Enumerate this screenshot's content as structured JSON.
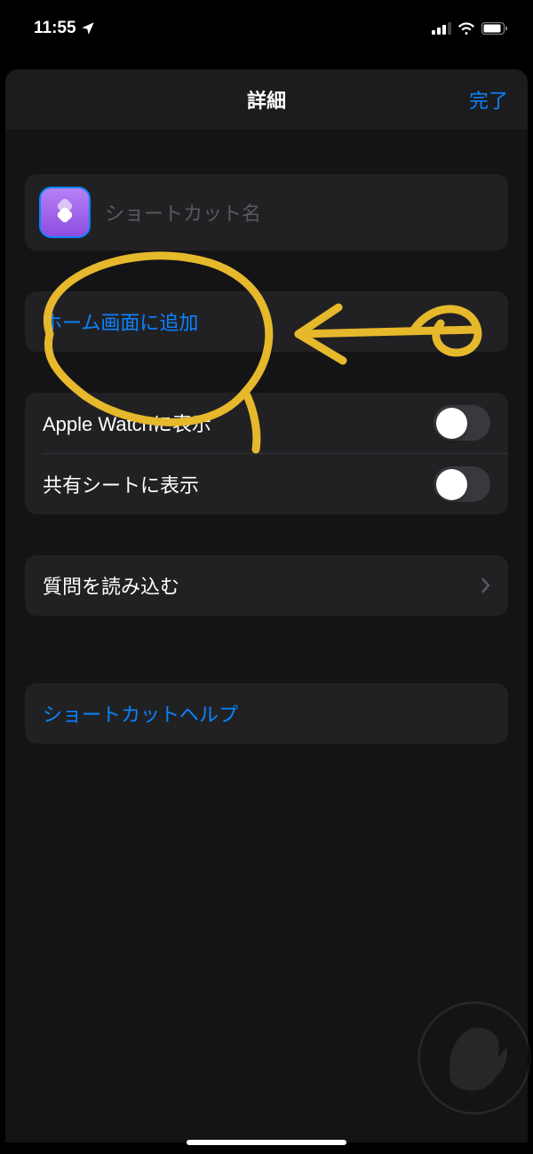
{
  "statusBar": {
    "time": "11:55"
  },
  "navBar": {
    "title": "詳細",
    "done": "完了"
  },
  "nameCell": {
    "placeholder": "ショートカット名"
  },
  "addHome": {
    "label": "ホーム画面に追加"
  },
  "toggles": {
    "appleWatch": "Apple Watchに表示",
    "shareSheet": "共有シートに表示"
  },
  "importQuestions": {
    "label": "質問を読み込む"
  },
  "help": {
    "label": "ショートカットヘルプ"
  }
}
